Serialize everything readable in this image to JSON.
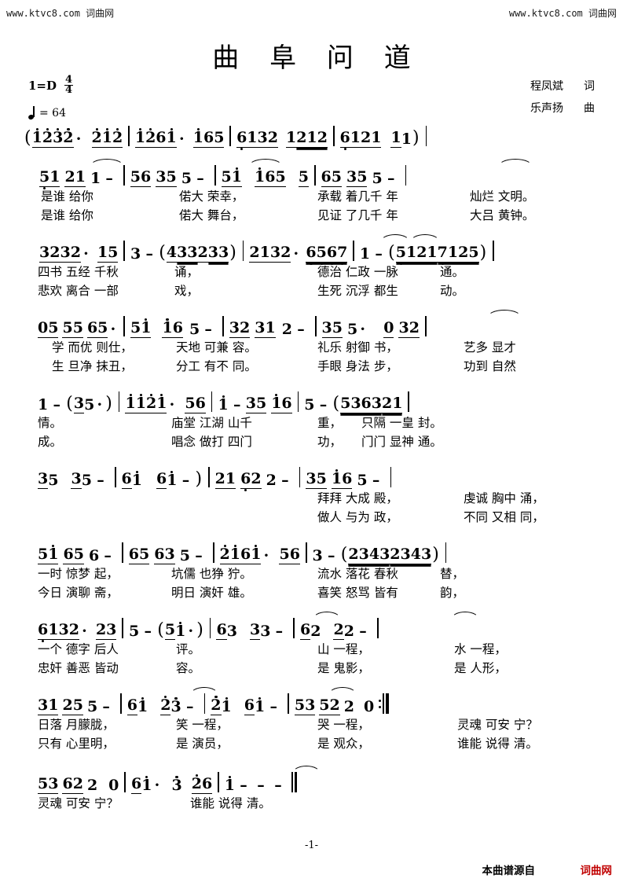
{
  "watermark": {
    "left": "www.ktvc8.com 词曲网",
    "right": "www.ktvc8.com  词曲网"
  },
  "header": {
    "title": "曲 阜 问 道",
    "key_label": "1=D",
    "time_top": "4",
    "time_bottom": "4",
    "tempo_equals": "= 64",
    "lyricist_name": "程凤斌",
    "lyricist_role": "词",
    "composer_name": "乐声扬",
    "composer_role": "曲"
  },
  "footer": {
    "page_number": "-1-",
    "source_note": "本曲谱源自",
    "brand": "词曲网"
  },
  "chart_data": {
    "type": "table",
    "title": "曲阜问道 — 简谱 (jianpu numbered notation)",
    "key": "1=D",
    "time_signature": "4/4",
    "tempo_bpm": 64,
    "lyrics_verse_1": "是谁给你 偌大荣幸，承载着几千年灿烂文明。四书五经千秋诵，德治仁政一脉通。学而优则仕，天地可兼容。礼乐射御书，艺多显才情。庙堂江湖山千重，只隔一皇封。拜拜大成殿，虔诚胸中涌，一时惊梦起，坑儒也狰狞。流水落花春秋替，一个德字后人评。山一程，水一程，日落月朦胧，笑一程，哭一程，灵魂可安宁？谁能说得清。",
    "lyrics_verse_2": "是谁给你 偌大舞台，见证了几千年大吕黄钟。悲欢离合一部戏，生死沉浮都生动。生旦净抹丑，分工有不同。手眼身法步，功到自然成。唱念做打四门功，门门显神通。做人与为政，不同又相同，今日演聊斋，明日演奸雄。喜笑怒骂皆有韵，忠奸善恶皆动容。是鬼影，是人形，只有心里明，是演员，是观众，谁能说得清。"
  },
  "score": {
    "lines": [
      {
        "id": "line-1-intro",
        "measures": [
          "( 1̇ 2̇ 3̇ 2̇ ·  2̇ 1̇ 2̇",
          "1̇ 2̇ 6 1̇ ·  1̇ 6 5",
          "6 1 3 2  1 2 1 2",
          "6 1 2 1  1 1 )"
        ],
        "lyrics1": [],
        "lyrics2": []
      },
      {
        "id": "line-2",
        "measures": [
          "5 1 2 1 1  –",
          "5 6 3 5 5  –",
          "5 1̇  1̇ 6 5  5",
          "6 5 3 5 5  –"
        ],
        "lyrics1": [
          "是谁 给你",
          "偌大 荣幸，",
          "承载 着几千 年",
          "灿烂 文明。"
        ],
        "lyrics2": [
          "是谁 给你",
          "偌大 舞台，",
          "见证 了几千 年",
          "大吕 黄钟。"
        ]
      },
      {
        "id": "line-3",
        "measures": [
          "3 2 3 2 ·  1 5",
          "3  – ( 4 3 3 2 3 3 )",
          "2 1 3 2 ·  6 5 6 7",
          "1  – ( 5 1 2 1  7 1 2 5 )"
        ],
        "lyrics1": [
          "四书 五经  千秋",
          "诵，",
          "德治 仁政  一脉",
          "通。"
        ],
        "lyrics2": [
          "悲欢 离合  一部",
          "戏，",
          "生死 沉浮  都生",
          "动。"
        ]
      },
      {
        "id": "line-4",
        "measures": [
          "0 5 5 5 5 6 5 ·",
          "5 1̇  1̇ 6 5  –",
          "3 2 3 1 2  –",
          "3 5 5 ·  0 3 2"
        ],
        "lyrics1": [
          "学 而优 则仕，",
          "天地 可兼 容。",
          "礼乐 射御 书，",
          "艺多      显才"
        ],
        "lyrics2": [
          "生 旦净 抹丑，",
          "分工 有不 同。",
          "手眼 身法 步，",
          "功到      自然"
        ]
      },
      {
        "id": "line-5",
        "measures": [
          "1  – ( 3 5 · )",
          "1̇ 1̇ 2̇ 1̇ ·  5 6",
          "1̇  –  3 5 1̇ 6",
          "5  – ( 5 3 6 3 2 1"
        ],
        "lyrics1": [
          "情。",
          "庙堂 江湖  山千",
          "重，",
          "只隔 一皇  封。"
        ],
        "lyrics2": [
          "成。",
          "唱念 做打  四门",
          "功，",
          "门门 显神  通。"
        ]
      },
      {
        "id": "line-6",
        "measures": [
          "3 5  3 5  –",
          "6 1̇  6 1̇  – )",
          "2 1 6 2 2  –",
          "3 5 1̇ 6 5  –"
        ],
        "lyrics1": [
          "",
          "",
          "拜拜 大成 殿，",
          "虔诚 胸中 涌，"
        ],
        "lyrics2": [
          "",
          "",
          "做人 与为 政，",
          "不同 又相 同，"
        ]
      },
      {
        "id": "line-7",
        "measures": [
          "5 1̇ 6 5 6  –",
          "6 5 6 3 5  –",
          "2̇ 1̇ 6 1̇ ·  5 6",
          "3  – ( 2 3 4 3  2 3 4 3 )"
        ],
        "lyrics1": [
          "一时 惊梦 起，",
          "坑儒 也狰 狞。",
          "流水 落花  春秋",
          "替，"
        ],
        "lyrics2": [
          "今日 演聊 斋，",
          "明日 演奸 雄。",
          "喜笑 怒骂  皆有",
          "韵，"
        ]
      },
      {
        "id": "line-8",
        "measures": [
          "6 1 3 2 ·  2 3",
          "5  – ( 5 1̇ · )",
          "6 3  3 3  –",
          "6 2  2 2  –"
        ],
        "lyrics1": [
          "一个 德字  后人",
          "评。",
          "山   一程，",
          "水   一程，"
        ],
        "lyrics2": [
          "忠奸 善恶  皆动",
          "容。",
          "是   鬼影，",
          "是   人形，"
        ]
      },
      {
        "id": "line-9",
        "measures": [
          "3 1 2 5 5  –",
          "6 1̇  2̇ 3  –",
          "2̇ 1̇  6 1̇  –",
          "5 3 5 2 2  0 :||"
        ],
        "lyrics1": [
          "日落 月朦胧，",
          "笑   一程，",
          "哭   一程，",
          "灵魂 可安 宁？"
        ],
        "lyrics2": [
          "只有 心里明，",
          "是   演员，",
          "是   观众，",
          "谁能 说得 清。"
        ]
      },
      {
        "id": "line-10-ending",
        "measures": [
          "5 3 6 2 2  0",
          "6 1̇ ·  3 2 6",
          "1̇  – – – ||"
        ],
        "lyrics1": [
          "灵魂 可安 宁？",
          "谁能  说得   清。"
        ],
        "lyrics2": []
      }
    ]
  }
}
